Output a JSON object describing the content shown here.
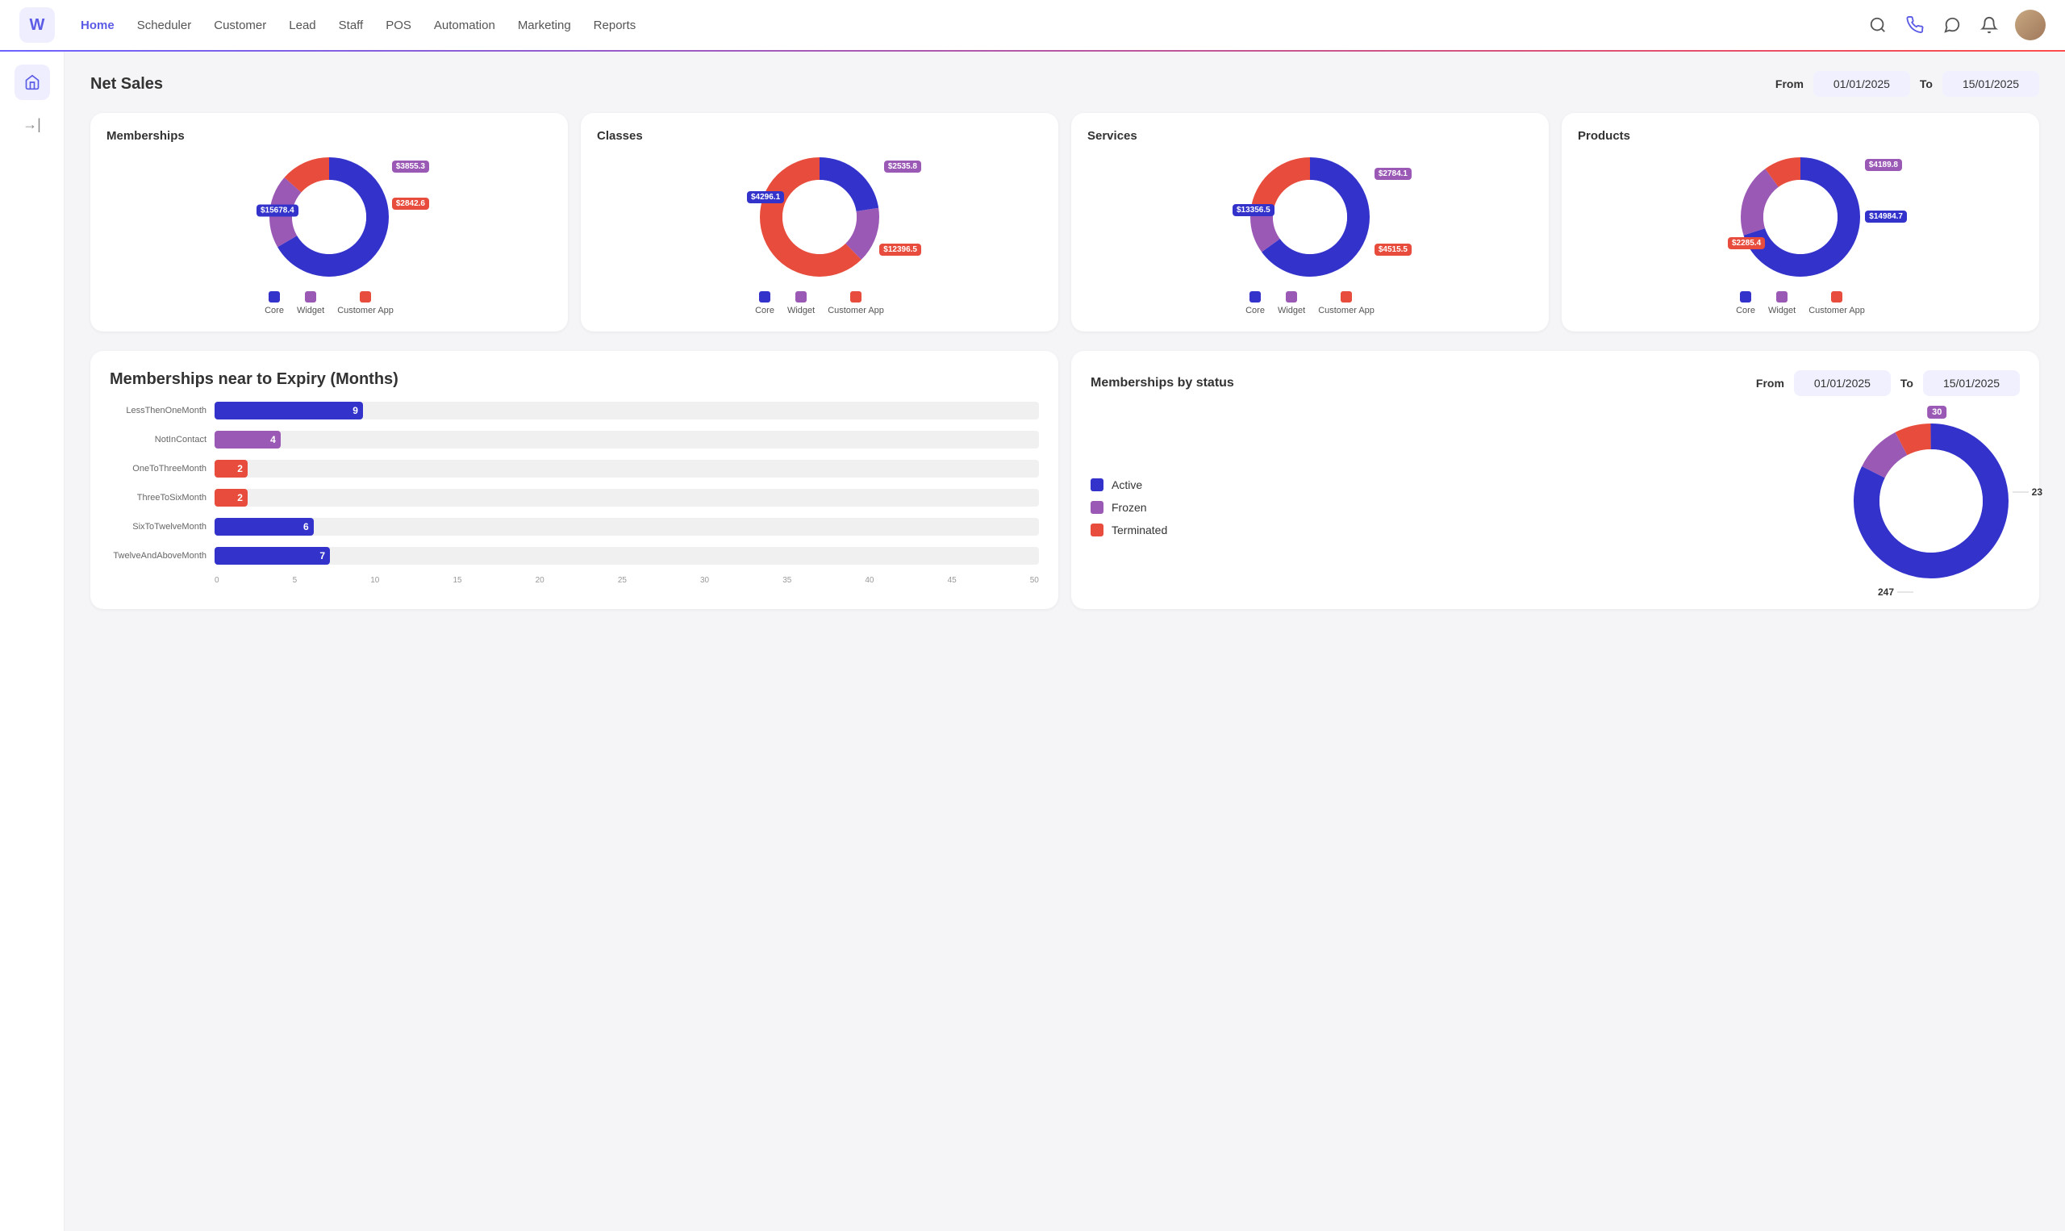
{
  "app": {
    "logo": "W"
  },
  "nav": {
    "items": [
      {
        "label": "Home",
        "active": true
      },
      {
        "label": "Scheduler",
        "active": false
      },
      {
        "label": "Customer",
        "active": false
      },
      {
        "label": "Lead",
        "active": false
      },
      {
        "label": "Staff",
        "active": false
      },
      {
        "label": "POS",
        "active": false
      },
      {
        "label": "Automation",
        "active": false
      },
      {
        "label": "Marketing",
        "active": false
      },
      {
        "label": "Reports",
        "active": false
      }
    ]
  },
  "net_sales": {
    "title": "Net Sales",
    "from_label": "From",
    "to_label": "To",
    "from_date": "01/01/2025",
    "to_date": "15/01/2025"
  },
  "charts": {
    "memberships": {
      "title": "Memberships",
      "segments": [
        {
          "label": "$15678.4",
          "color": "#3333cc",
          "value": 215
        },
        {
          "label": "$3855.3",
          "color": "#9b59b6",
          "value": 60
        },
        {
          "label": "$2842.6",
          "color": "#e74c3c",
          "value": 45
        }
      ],
      "legend": [
        "Core",
        "Widget",
        "Customer App"
      ],
      "colors": [
        "#3333cc",
        "#9b59b6",
        "#e74c3c"
      ]
    },
    "classes": {
      "title": "Classes",
      "segments": [
        {
          "label": "$4296.1",
          "color": "#3333cc",
          "value": 90
        },
        {
          "label": "$2535.8",
          "color": "#9b59b6",
          "value": 60
        },
        {
          "label": "$12396.5",
          "color": "#e74c3c",
          "value": 210
        }
      ],
      "legend": [
        "Core",
        "Widget",
        "Customer App"
      ],
      "colors": [
        "#3333cc",
        "#9b59b6",
        "#e74c3c"
      ]
    },
    "services": {
      "title": "Services",
      "segments": [
        {
          "label": "$13356.5",
          "color": "#3333cc",
          "value": 200
        },
        {
          "label": "$2784.1",
          "color": "#9b59b6",
          "value": 50
        },
        {
          "label": "$4515.5",
          "color": "#e74c3c",
          "value": 70
        }
      ],
      "legend": [
        "Core",
        "Widget",
        "Customer App"
      ],
      "colors": [
        "#3333cc",
        "#9b59b6",
        "#e74c3c"
      ]
    },
    "products": {
      "title": "Products",
      "segments": [
        {
          "label": "$14984.7",
          "color": "#3333cc",
          "value": 200
        },
        {
          "label": "$4189.8",
          "color": "#9b59b6",
          "value": 65
        },
        {
          "label": "$2285.4",
          "color": "#e74c3c",
          "value": 40
        }
      ],
      "legend": [
        "Core",
        "Widget",
        "Customer App"
      ],
      "colors": [
        "#3333cc",
        "#9b59b6",
        "#e74c3c"
      ]
    }
  },
  "expiry": {
    "title": "Memberships near to Expiry (Months)",
    "bars": [
      {
        "label": "LessThenOneMonth",
        "value": 9,
        "max": 50,
        "color": "#3333cc"
      },
      {
        "label": "NotInContact",
        "value": 4,
        "max": 50,
        "color": "#9b59b6"
      },
      {
        "label": "OneToThreeMonth",
        "value": 2,
        "max": 50,
        "color": "#e74c3c"
      },
      {
        "label": "ThreeToSixMonth",
        "value": 2,
        "max": 50,
        "color": "#e74c3c"
      },
      {
        "label": "SixToTwelveMonth",
        "value": 6,
        "max": 50,
        "color": "#3333cc"
      },
      {
        "label": "TwelveAndAboveMonth",
        "value": 7,
        "max": 50,
        "color": "#3333cc"
      }
    ],
    "axis": [
      "0",
      "5",
      "10",
      "15",
      "20",
      "25",
      "30",
      "35",
      "40",
      "45",
      "50"
    ]
  },
  "memberships_status": {
    "title": "Memberships by status",
    "from_label": "From",
    "to_label": "To",
    "from_date": "01/01/2025",
    "to_date": "15/01/2025",
    "legend": [
      {
        "label": "Active",
        "color": "#3333cc"
      },
      {
        "label": "Frozen",
        "color": "#9b59b6"
      },
      {
        "label": "Terminated",
        "color": "#e74c3c"
      }
    ],
    "donut": {
      "active": {
        "value": 247,
        "label": "247",
        "color": "#3333cc"
      },
      "frozen": {
        "value": 30,
        "label": "30",
        "color": "#9b59b6"
      },
      "terminated": {
        "value": 23,
        "label": "23",
        "color": "#e74c3c"
      }
    }
  }
}
